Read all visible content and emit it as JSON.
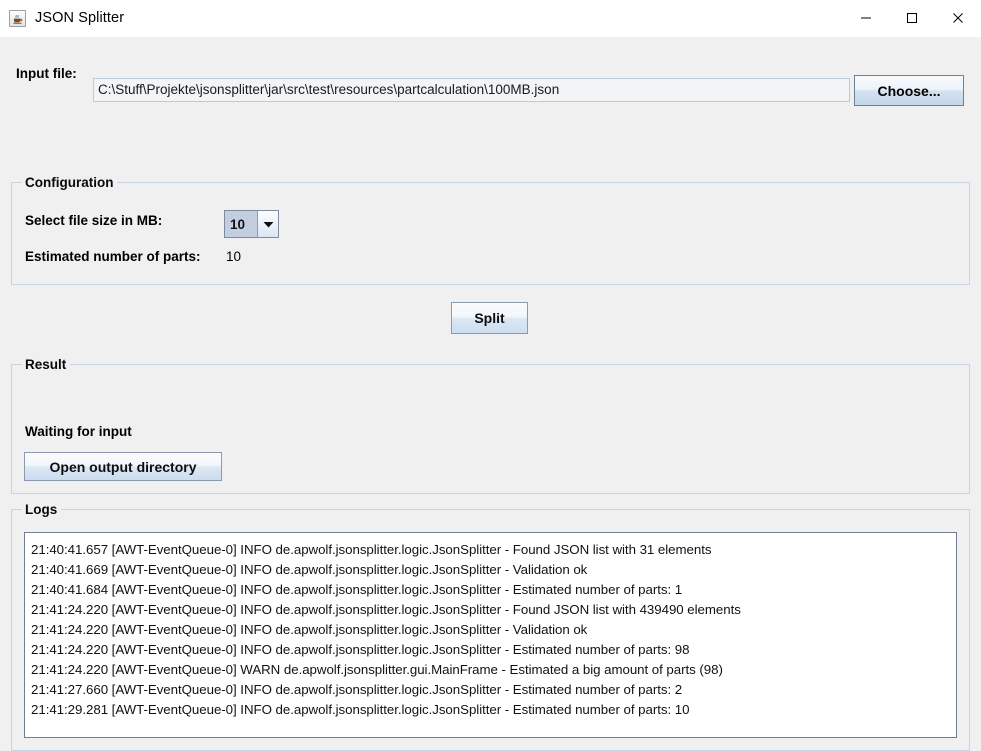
{
  "window": {
    "title": "JSON Splitter",
    "icon": "java-coffee-cup-icon",
    "controls": {
      "minimize_label": "—",
      "maximize_label": "□",
      "close_label": "✕"
    }
  },
  "input_file": {
    "label": "Input file:",
    "value": "C:\\Stuff\\Projekte\\jsonsplitter\\jar\\src\\test\\resources\\partcalculation\\100MB.json",
    "placeholder": "",
    "choose_label": "Choose..."
  },
  "configuration": {
    "title": "Configuration",
    "file_size_label": "Select file size in MB:",
    "file_size_value": "10",
    "file_size_options": [
      "10"
    ],
    "estimated_parts_label": "Estimated number of parts:",
    "estimated_parts_value": "10"
  },
  "split": {
    "label": "Split"
  },
  "result": {
    "title": "Result",
    "status": "Waiting for input",
    "open_output_label": "Open output directory"
  },
  "logs": {
    "title": "Logs",
    "lines": [
      "21:40:41.657 [AWT-EventQueue-0] INFO  de.apwolf.jsonsplitter.logic.JsonSplitter - Found JSON list with 31 elements",
      "21:40:41.669 [AWT-EventQueue-0] INFO  de.apwolf.jsonsplitter.logic.JsonSplitter - Validation ok",
      "21:40:41.684 [AWT-EventQueue-0] INFO  de.apwolf.jsonsplitter.logic.JsonSplitter - Estimated number of parts: 1",
      "21:41:24.220 [AWT-EventQueue-0] INFO  de.apwolf.jsonsplitter.logic.JsonSplitter - Found JSON list with 439490 elements",
      "21:41:24.220 [AWT-EventQueue-0] INFO  de.apwolf.jsonsplitter.logic.JsonSplitter - Validation ok",
      "21:41:24.220 [AWT-EventQueue-0] INFO  de.apwolf.jsonsplitter.logic.JsonSplitter - Estimated number of parts: 98",
      "21:41:24.220 [AWT-EventQueue-0] WARN  de.apwolf.jsonsplitter.gui.MainFrame - Estimated a big amount of parts (98)",
      "21:41:27.660 [AWT-EventQueue-0] INFO  de.apwolf.jsonsplitter.logic.JsonSplitter - Estimated number of parts: 2",
      "21:41:29.281 [AWT-EventQueue-0] INFO  de.apwolf.jsonsplitter.logic.JsonSplitter - Estimated number of parts: 10"
    ]
  },
  "colors": {
    "window_background": "#f0f0f0",
    "panel_border": "#c8d4e4",
    "button_border": "#8b9aae",
    "field_border": "#bcc9de",
    "text_area_background": "#ffffff",
    "combo_selection": "#c3cfe0"
  }
}
